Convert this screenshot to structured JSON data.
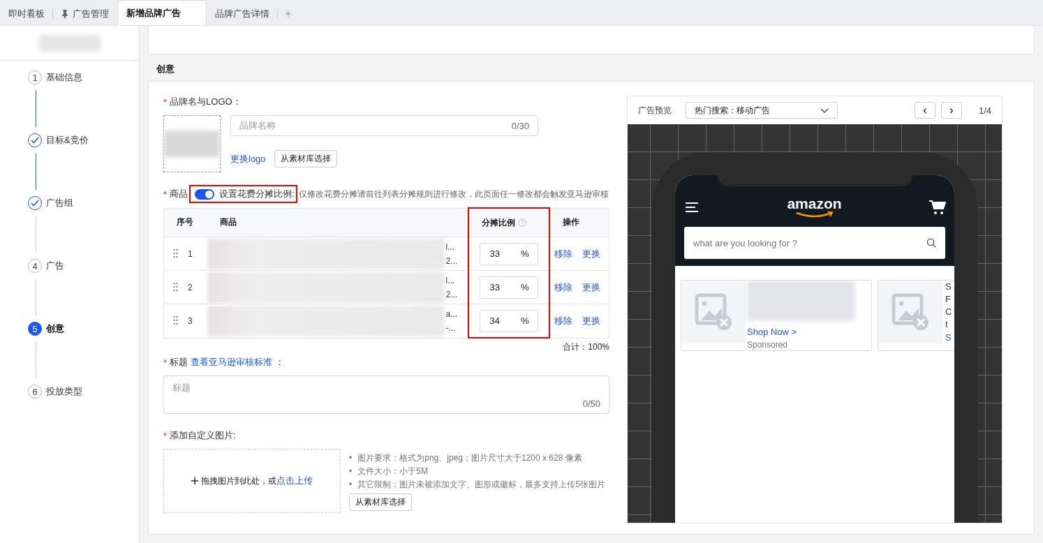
{
  "tabs": [
    {
      "label": "即时看板",
      "selected": false,
      "pinned": false
    },
    {
      "label": "广告管理",
      "selected": false,
      "pinned": true
    },
    {
      "label": "新增品牌广告",
      "selected": true,
      "pinned": false
    },
    {
      "label": "品牌广告详情",
      "selected": false,
      "pinned": false
    }
  ],
  "add_tab": "+",
  "steps": [
    {
      "kind": "pending",
      "number": "1",
      "label": "基础信息"
    },
    {
      "kind": "done",
      "label": "目标&竞价"
    },
    {
      "kind": "done",
      "label": "广告组"
    },
    {
      "kind": "pending",
      "number": "4",
      "label": "广告"
    },
    {
      "kind": "active",
      "number": "5",
      "label": "创意"
    },
    {
      "kind": "pending",
      "number": "6",
      "label": "投放类型"
    }
  ],
  "section_title": "创意",
  "brand": {
    "required_mark": "*",
    "label": "品牌名与LOGO：",
    "name_placeholder": "品牌名称",
    "counter": "0/30",
    "change_logo": "更换logo",
    "library_button": "从素材库选择"
  },
  "products": {
    "required_mark": "*",
    "label": "商品",
    "split_toggle": {
      "on": true,
      "label": "设置花费分摊比例:",
      "highlighted": true
    },
    "note": "仅修改花费分摊请前往列表分摊规则进行修改，此页面任一修改都会触发亚马逊审核",
    "columns": [
      {
        "label": "序号",
        "help": false,
        "highlighted": false
      },
      {
        "label": "商品",
        "help": false,
        "highlighted": false
      },
      {
        "label": "分摊比例",
        "help": true,
        "highlighted": true
      },
      {
        "label": "操作",
        "help": false,
        "highlighted": false
      }
    ],
    "rows": [
      {
        "index": "1",
        "fragments": [
          "l...",
          "2..."
        ],
        "ratio": "33",
        "unit": "%",
        "remove": "移除",
        "replace": "更换"
      },
      {
        "index": "2",
        "fragments": [
          "l...",
          "2..."
        ],
        "ratio": "33",
        "unit": "%",
        "remove": "移除",
        "replace": "更换"
      },
      {
        "index": "3",
        "fragments": [
          "a...",
          "-..."
        ],
        "ratio": "34",
        "unit": "%",
        "remove": "移除",
        "replace": "更换"
      }
    ],
    "total": "合计：100%"
  },
  "headline": {
    "required_mark": "*",
    "label": "标题",
    "link": "查看亚马逊审核标准",
    "colon": "：",
    "placeholder": "标题",
    "counter": "0/50"
  },
  "images": {
    "required_mark": "*",
    "label": "添加自定义图片:",
    "drop_text": "拖拽图片到此处，或",
    "upload_link": "点击上传",
    "rules": [
      {
        "bullet": "•",
        "text": "图片要求：格式为png、jpeg；图片尺寸大于1200 x 628 像素"
      },
      {
        "bullet": "•",
        "text": "文件大小：小于5M"
      },
      {
        "bullet": "•",
        "text": "其它限制：图片未被添加文字、图形或徽标，最多支持上传5张图片"
      }
    ],
    "library_button": "从素材库选择"
  },
  "preview": {
    "label": "广告预览",
    "select": "热门搜索：移动广告",
    "prev": "‹",
    "next": "›",
    "page": "1/4",
    "phone": {
      "logo": "amazon",
      "search_placeholder": "what are you looking for ?",
      "cards": [
        {
          "link": "Shop Now >",
          "sponsored": "Sponsored"
        },
        {
          "lines": [
            "S",
            "F",
            "C",
            "t"
          ],
          "link": "S"
        }
      ]
    }
  }
}
